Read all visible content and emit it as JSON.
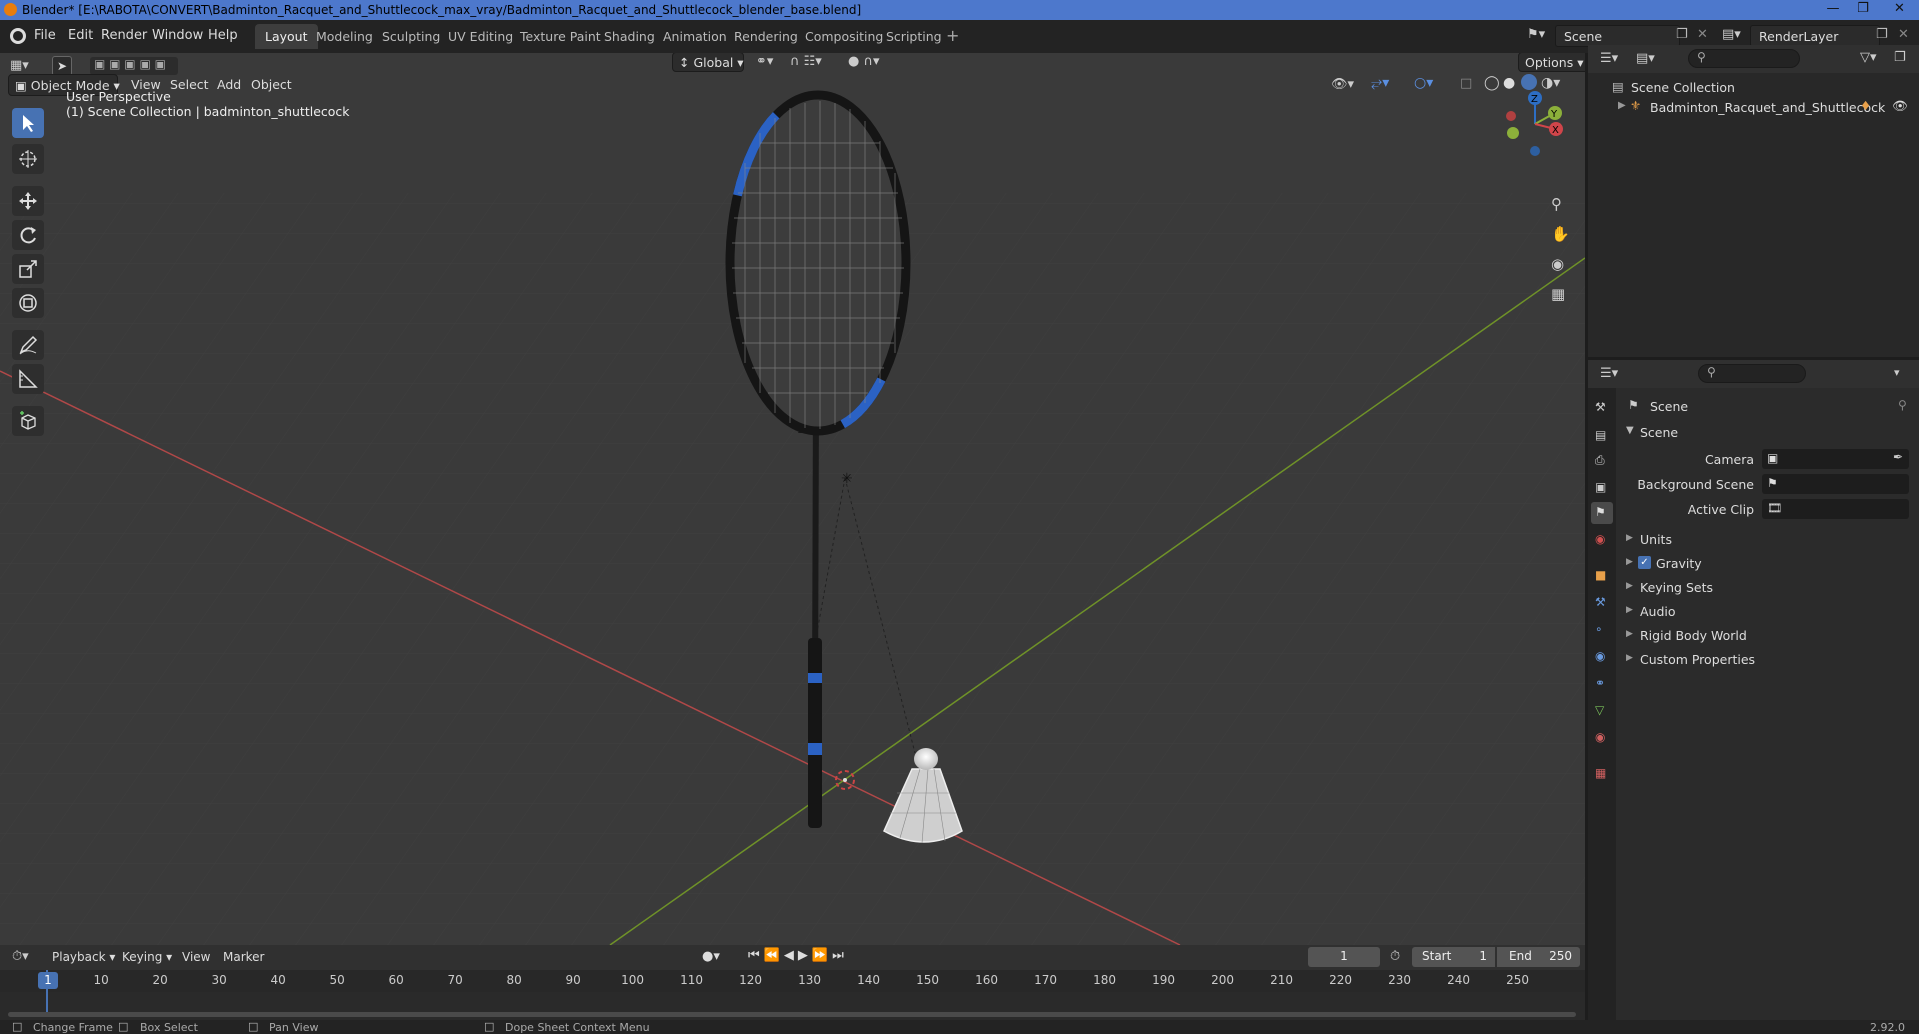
{
  "window": {
    "title": "Blender* [E:\\RABOTA\\CONVERT\\Badminton_Racquet_and_Shuttlecock_max_vray/Badminton_Racquet_and_Shuttlecock_blender_base.blend]"
  },
  "menu": [
    "File",
    "Edit",
    "Render",
    "Window",
    "Help"
  ],
  "workspaces": [
    "Layout",
    "Modeling",
    "Sculpting",
    "UV Editing",
    "Texture Paint",
    "Shading",
    "Animation",
    "Rendering",
    "Compositing",
    "Scripting"
  ],
  "scene_field": "Scene",
  "renderlayer_field": "RenderLayer",
  "header": {
    "transform_orientation": "Global",
    "options": "Options",
    "mode": "Object Mode",
    "view_menu": [
      "View",
      "Select",
      "Add",
      "Object"
    ]
  },
  "viewport": {
    "perspective": "User Perspective",
    "collection_info": "(1) Scene Collection | badminton_shuttlecock",
    "gizmo_axes": [
      "Z",
      "Y",
      "X"
    ]
  },
  "outliner": {
    "root": "Scene Collection",
    "item": "Badminton_Racquet_and_Shuttlecock"
  },
  "properties": {
    "title": "Scene",
    "section": "Scene",
    "fields": [
      {
        "label": "Camera"
      },
      {
        "label": "Background Scene"
      },
      {
        "label": "Active Clip"
      }
    ],
    "panels": [
      "Units",
      "Gravity",
      "Keying Sets",
      "Audio",
      "Rigid Body World",
      "Custom Properties"
    ],
    "gravity_checked": true
  },
  "timeline": {
    "menus": [
      "Playback",
      "Keying",
      "View",
      "Marker"
    ],
    "current_frame": "1",
    "start_label": "Start",
    "start": "1",
    "end_label": "End",
    "end": "250",
    "ticks": [
      "1",
      "10",
      "20",
      "30",
      "40",
      "50",
      "60",
      "70",
      "80",
      "90",
      "100",
      "110",
      "120",
      "130",
      "140",
      "150",
      "160",
      "170",
      "180",
      "190",
      "200",
      "210",
      "220",
      "230",
      "240",
      "250"
    ]
  },
  "status": {
    "items": [
      "Change Frame",
      "Box Select",
      "Pan View",
      "Dope Sheet Context Menu"
    ],
    "version": "2.92.0"
  },
  "colors": {
    "accent": "#4772b3",
    "title_bar": "#4d78cc",
    "viewport_bg": "#393939",
    "x_axis": "#c34b4b",
    "y_axis": "#7fa031",
    "racquet_accent": "#2b62c4"
  }
}
